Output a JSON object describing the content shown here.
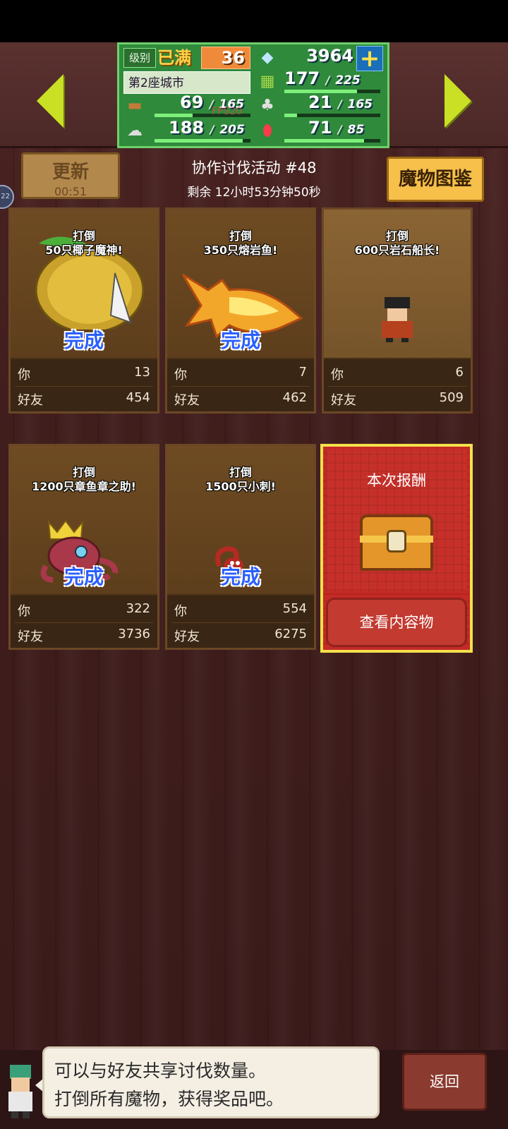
{
  "stats": {
    "level_label": "级别",
    "level_full": "已满",
    "level_value": "36",
    "gems": "3964",
    "city": "第2座城市",
    "row2_val": "177",
    "row2_max": "225",
    "wood_val": "69",
    "wood_max": "165",
    "food_val": "21",
    "food_max": "165",
    "stone_val": "188",
    "stone_max": "205",
    "ruby_val": "71",
    "ruby_max": "85",
    "fps": "FPS20",
    "slash": "/"
  },
  "header": {
    "refresh_label": "更新",
    "refresh_time": "00:51",
    "event_title": "协作讨伐活动 #48",
    "event_remain": "剩余 12小时53分钟50秒",
    "bestiary_label": "魔物图鉴",
    "side_badge": "22"
  },
  "cards": [
    {
      "title1": "打倒",
      "title2": "50只椰子魔神!",
      "done": "完成",
      "you_label": "你",
      "you": "13",
      "friend_label": "好友",
      "friends": "454"
    },
    {
      "title1": "打倒",
      "title2": "350只熔岩鱼!",
      "done": "完成",
      "you_label": "你",
      "you": "7",
      "friend_label": "好友",
      "friends": "462"
    },
    {
      "title1": "打倒",
      "title2": "600只岩石船长!",
      "done": "",
      "you_label": "你",
      "you": "6",
      "friend_label": "好友",
      "friends": "509"
    },
    {
      "title1": "打倒",
      "title2": "1200只章鱼章之助!",
      "done": "完成",
      "you_label": "你",
      "you": "322",
      "friend_label": "好友",
      "friends": "3736"
    },
    {
      "title1": "打倒",
      "title2": "1500只小刺!",
      "done": "完成",
      "you_label": "你",
      "you": "554",
      "friend_label": "好友",
      "friends": "6275"
    }
  ],
  "reward": {
    "title": "本次报酬",
    "view_label": "查看内容物"
  },
  "bottom": {
    "line1": "可以与好友共享讨伐数量。",
    "line2": "打倒所有魔物，获得奖品吧。",
    "back_label": "返回"
  },
  "colors": {
    "accent_green": "#2f8a3b",
    "arrow": "#c9e024",
    "done_blue": "#2a5fff",
    "reward_red": "#c42a26"
  }
}
